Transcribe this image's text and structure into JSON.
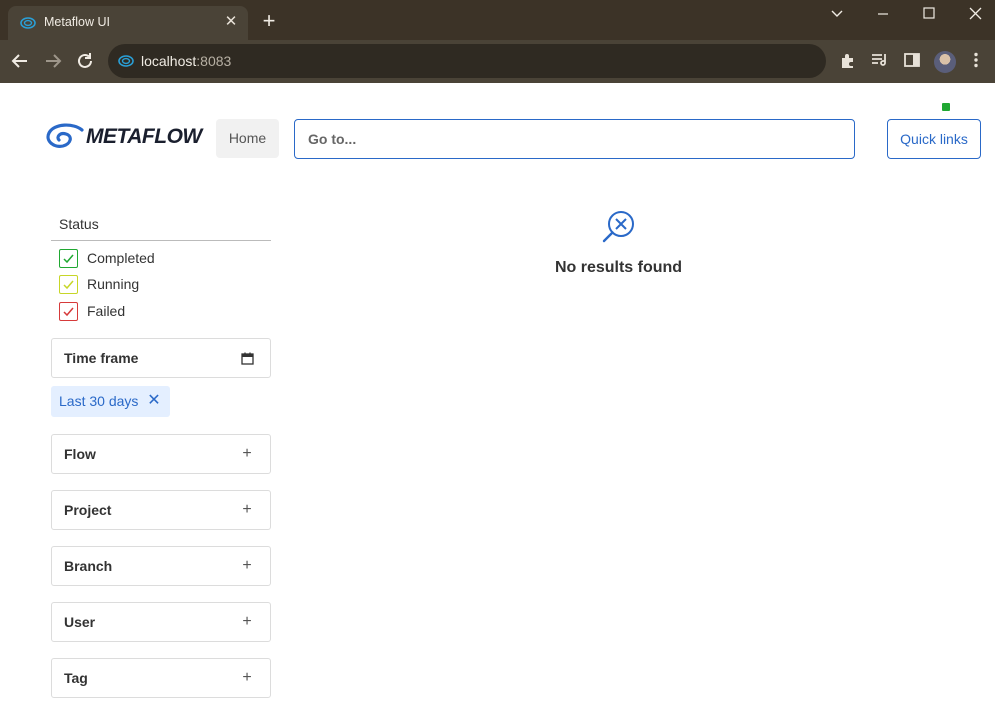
{
  "browser": {
    "tab_title": "Metaflow UI",
    "tab_close_icon": "close-icon",
    "new_tab_icon": "plus-icon",
    "window_controls": [
      "chevron-down-icon",
      "minimize-icon",
      "maximize-icon",
      "close-icon"
    ],
    "url_host": "localhost",
    "url_port": ":8083",
    "toolbar_icons": [
      "extensions-icon",
      "media-control-icon",
      "side-panel-icon",
      "profile-avatar",
      "more-menu-icon"
    ]
  },
  "header": {
    "logo_text": "METAFLOW",
    "home_label": "Home",
    "search": {
      "placeholder": "Go to...",
      "value": ""
    },
    "quick_links_label": "Quick links",
    "connection_status_color": "#20a832"
  },
  "sidebar": {
    "status_title": "Status",
    "statuses": [
      {
        "label": "Completed",
        "checked": true,
        "color": "#20a832"
      },
      {
        "label": "Running",
        "checked": true,
        "color": "#c7d628"
      },
      {
        "label": "Failed",
        "checked": true,
        "color": "#d63a3a"
      }
    ],
    "time_frame": {
      "label": "Time frame",
      "icon": "calendar-icon",
      "selected": "Last 30 days"
    },
    "filters": [
      {
        "label": "Flow",
        "icon": "plus-icon"
      },
      {
        "label": "Project",
        "icon": "plus-icon"
      },
      {
        "label": "Branch",
        "icon": "plus-icon"
      },
      {
        "label": "User",
        "icon": "plus-icon"
      },
      {
        "label": "Tag",
        "icon": "plus-icon"
      }
    ]
  },
  "main": {
    "empty_icon": "search-no-results-icon",
    "empty_message": "No results found"
  },
  "colors": {
    "accent": "#2a69c8",
    "chrome_dark": "#3c3327",
    "chrome_toolbar": "#4a4337"
  }
}
